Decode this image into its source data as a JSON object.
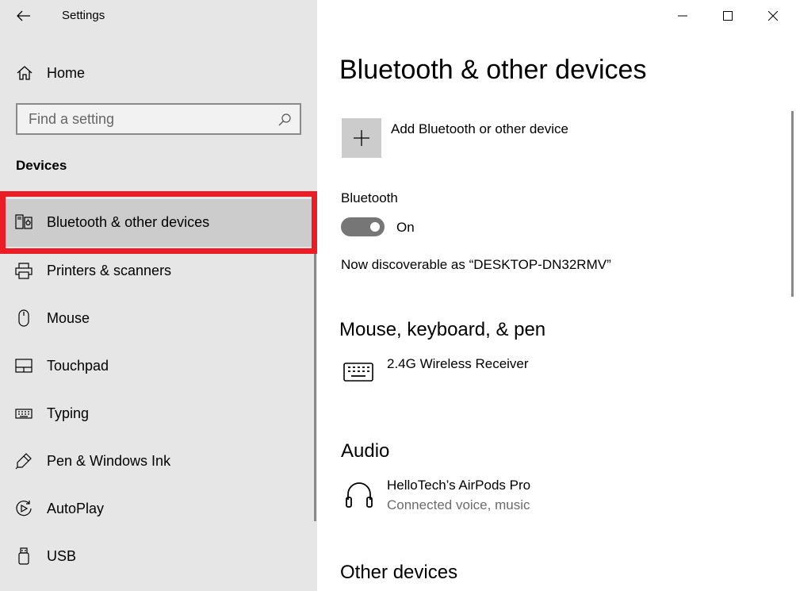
{
  "window": {
    "title": "Settings",
    "controls": [
      "minimize-icon",
      "maximize-icon",
      "close-icon"
    ]
  },
  "sidebar": {
    "home_label": "Home",
    "search": {
      "placeholder": "Find a setting",
      "value": ""
    },
    "section_title": "Devices",
    "items": [
      {
        "label": "Bluetooth & other devices",
        "icon": "bluetooth-devices-icon",
        "selected": true
      },
      {
        "label": "Printers & scanners",
        "icon": "printer-icon"
      },
      {
        "label": "Mouse",
        "icon": "mouse-icon"
      },
      {
        "label": "Touchpad",
        "icon": "touchpad-icon"
      },
      {
        "label": "Typing",
        "icon": "keyboard-icon"
      },
      {
        "label": "Pen & Windows Ink",
        "icon": "pen-icon"
      },
      {
        "label": "AutoPlay",
        "icon": "autoplay-icon"
      },
      {
        "label": "USB",
        "icon": "usb-icon"
      }
    ]
  },
  "main": {
    "title": "Bluetooth & other devices",
    "add_device_label": "Add Bluetooth or other device",
    "bluetooth": {
      "label": "Bluetooth",
      "state": "On",
      "enabled": true,
      "discoverable_text": "Now discoverable as “DESKTOP-DN32RMV”"
    },
    "sections": {
      "input": {
        "title": "Mouse, keyboard, & pen",
        "devices": [
          {
            "name": "2.4G Wireless Receiver",
            "status": "",
            "icon": "keyboard-icon"
          }
        ]
      },
      "audio": {
        "title": "Audio",
        "devices": [
          {
            "name": "HelloTech’s AirPods Pro",
            "status": "Connected voice, music",
            "icon": "headphones-icon"
          }
        ]
      },
      "other": {
        "title": "Other devices"
      }
    }
  },
  "colors": {
    "sidebar_bg": "#e6e6e6",
    "selected_bg": "#cccccc",
    "highlight": "#ec1c24",
    "toggle_on": "#767676"
  }
}
